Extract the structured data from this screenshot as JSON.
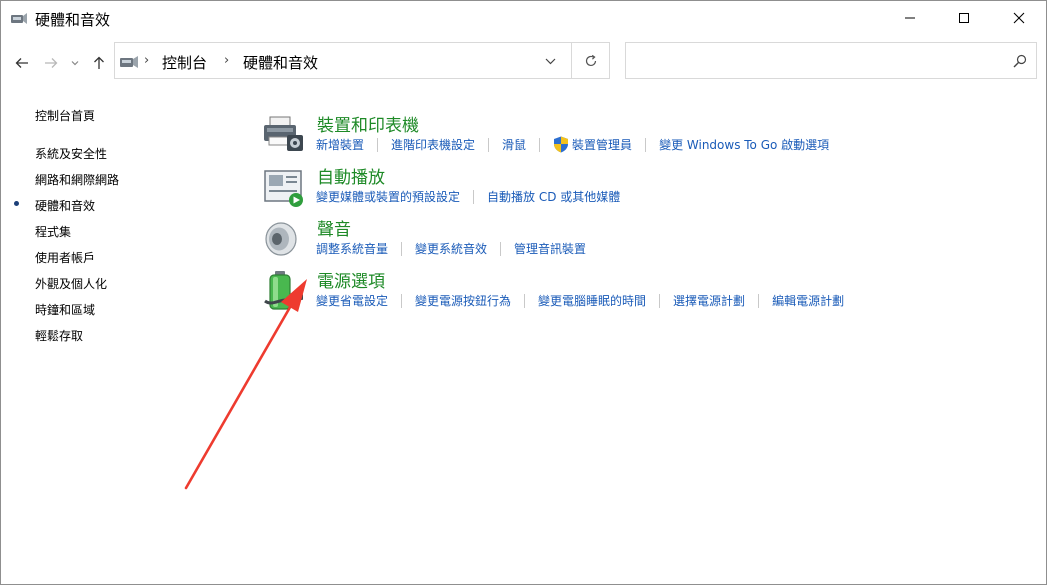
{
  "window": {
    "title": "硬體和音效"
  },
  "address": {
    "crumbs": [
      "控制台",
      "硬體和音效"
    ]
  },
  "search": {
    "placeholder": "",
    "value": ""
  },
  "sidebar": {
    "items": [
      {
        "label": "控制台首頁",
        "active": false
      },
      {
        "label": "系統及安全性",
        "active": false
      },
      {
        "label": "網路和網際網路",
        "active": false
      },
      {
        "label": "硬體和音效",
        "active": true
      },
      {
        "label": "程式集",
        "active": false
      },
      {
        "label": "使用者帳戶",
        "active": false
      },
      {
        "label": "外觀及個人化",
        "active": false
      },
      {
        "label": "時鐘和區域",
        "active": false
      },
      {
        "label": "輕鬆存取",
        "active": false
      }
    ]
  },
  "categories": [
    {
      "title": "裝置和印表機",
      "icon": "printer-icon",
      "links": [
        "新增裝置",
        "進階印表機設定",
        "滑鼠",
        "裝置管理員",
        "變更 Windows To Go 啟動選項"
      ]
    },
    {
      "title": "自動播放",
      "icon": "autoplay-icon",
      "links": [
        "變更媒體或裝置的預設設定",
        "自動播放 CD 或其他媒體"
      ]
    },
    {
      "title": "聲音",
      "icon": "speaker-icon",
      "links": [
        "調整系統音量",
        "變更系統音效",
        "管理音訊裝置"
      ]
    },
    {
      "title": "電源選項",
      "icon": "battery-icon",
      "links": [
        "變更省電設定",
        "變更電源按鈕行為",
        "變更電腦睡眠的時間",
        "選擇電源計劃",
        "編輯電源計劃"
      ]
    }
  ],
  "colors": {
    "link": "#1a5bb8",
    "category_title": "#1e8a27",
    "annotation_arrow": "#ee3b2f"
  }
}
